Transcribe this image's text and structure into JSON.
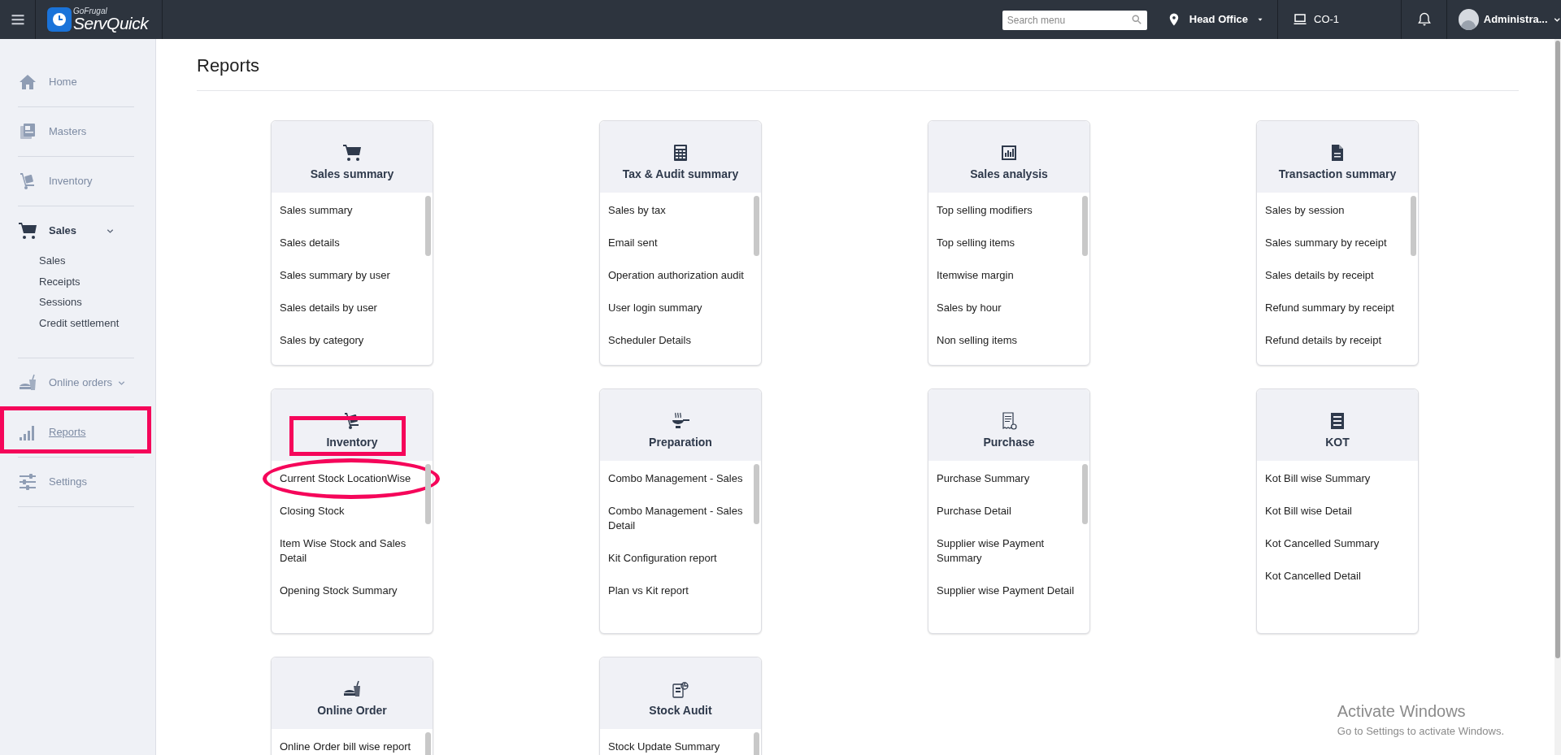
{
  "topbar": {
    "logo_small": "GoFrugal",
    "logo_large": "ServQuick",
    "search": {
      "placeholder": "Search menu"
    },
    "location": "Head Office",
    "terminal": "CO-1",
    "user": "Administra..."
  },
  "sidebar": {
    "items": [
      {
        "label": "Home",
        "kind": "home",
        "selected": false,
        "hovered": false,
        "highlighted": false
      },
      {
        "label": "Masters",
        "kind": "masters",
        "selected": false,
        "hovered": false,
        "highlighted": false
      },
      {
        "label": "Inventory",
        "kind": "trolley",
        "selected": false,
        "hovered": false,
        "highlighted": false
      },
      {
        "label": "Sales",
        "kind": "cart",
        "selected": true,
        "hovered": false,
        "highlighted": false,
        "expanded": true,
        "children": [
          {
            "label": "Sales"
          },
          {
            "label": "Receipts"
          },
          {
            "label": "Sessions"
          },
          {
            "label": "Credit settlement"
          }
        ]
      },
      {
        "label": "Online orders",
        "kind": "food",
        "selected": false,
        "hovered": false,
        "highlighted": false,
        "expanded": false
      },
      {
        "label": "Reports",
        "kind": "bars",
        "selected": false,
        "hovered": true,
        "highlighted": true
      },
      {
        "label": "Settings",
        "kind": "sliders",
        "selected": false,
        "hovered": false,
        "highlighted": false
      }
    ]
  },
  "page": {
    "title": "Reports"
  },
  "cards": [
    {
      "title": "Sales summary",
      "kind": "cart",
      "scrollable": true,
      "highlighted": false,
      "items": [
        {
          "label": "Sales summary",
          "circled": false
        },
        {
          "label": "Sales details",
          "circled": false
        },
        {
          "label": "Sales summary by user",
          "circled": false
        },
        {
          "label": "Sales details by user",
          "circled": false
        },
        {
          "label": "Sales by category",
          "circled": false
        }
      ]
    },
    {
      "title": "Tax & Audit summary",
      "kind": "calculator",
      "scrollable": true,
      "highlighted": false,
      "items": [
        {
          "label": "Sales by tax",
          "circled": false
        },
        {
          "label": "Email sent",
          "circled": false
        },
        {
          "label": "Operation authorization audit",
          "circled": false
        },
        {
          "label": "User login summary",
          "circled": false
        },
        {
          "label": "Scheduler Details",
          "circled": false
        }
      ]
    },
    {
      "title": "Sales analysis",
      "kind": "chart",
      "scrollable": true,
      "highlighted": false,
      "items": [
        {
          "label": "Top selling modifiers",
          "circled": false
        },
        {
          "label": "Top selling items",
          "circled": false
        },
        {
          "label": "Itemwise margin",
          "circled": false
        },
        {
          "label": "Sales by hour",
          "circled": false
        },
        {
          "label": "Non selling items",
          "circled": false
        }
      ]
    },
    {
      "title": "Transaction summary",
      "kind": "document",
      "scrollable": true,
      "highlighted": false,
      "items": [
        {
          "label": "Sales by session",
          "circled": false
        },
        {
          "label": "Sales summary by receipt",
          "circled": false
        },
        {
          "label": "Sales details by receipt",
          "circled": false
        },
        {
          "label": "Refund summary by receipt",
          "circled": false
        },
        {
          "label": "Refund details by receipt",
          "circled": false
        }
      ]
    },
    {
      "title": "Inventory",
      "kind": "trolley",
      "scrollable": true,
      "highlighted": true,
      "items": [
        {
          "label": "Current Stock LocationWise",
          "circled": true
        },
        {
          "label": "Closing Stock",
          "circled": false
        },
        {
          "label": "Item Wise Stock and Sales Detail",
          "circled": false
        },
        {
          "label": "Opening Stock Summary",
          "circled": false
        }
      ]
    },
    {
      "title": "Preparation",
      "kind": "pan",
      "scrollable": true,
      "highlighted": false,
      "items": [
        {
          "label": "Combo Management - Sales",
          "circled": false
        },
        {
          "label": "Combo Management - Sales Detail",
          "circled": false
        },
        {
          "label": "Kit Configuration report",
          "circled": false
        },
        {
          "label": "Plan vs Kit report",
          "circled": false
        }
      ]
    },
    {
      "title": "Purchase",
      "kind": "receipt",
      "scrollable": true,
      "highlighted": false,
      "items": [
        {
          "label": "Purchase Summary",
          "circled": false
        },
        {
          "label": "Purchase Detail",
          "circled": false
        },
        {
          "label": "Supplier wise Payment Summary",
          "circled": false
        },
        {
          "label": "Supplier wise Payment Detail",
          "circled": false
        }
      ]
    },
    {
      "title": "KOT",
      "kind": "list",
      "scrollable": false,
      "highlighted": false,
      "items": [
        {
          "label": "Kot Bill wise Summary",
          "circled": false
        },
        {
          "label": "Kot Bill wise Detail",
          "circled": false
        },
        {
          "label": "Kot Cancelled Summary",
          "circled": false
        },
        {
          "label": "Kot Cancelled Detail",
          "circled": false
        }
      ]
    },
    {
      "title": "Online Order",
      "kind": "food",
      "scrollable": true,
      "highlighted": false,
      "items": [
        {
          "label": "Online Order bill wise report",
          "circled": false
        }
      ]
    },
    {
      "title": "Stock Audit",
      "kind": "audit",
      "scrollable": true,
      "highlighted": false,
      "items": [
        {
          "label": "Stock Update Summary",
          "circled": false
        }
      ]
    }
  ],
  "os_notice": {
    "title": "Activate Windows",
    "text": "Go to Settings to activate Windows."
  }
}
